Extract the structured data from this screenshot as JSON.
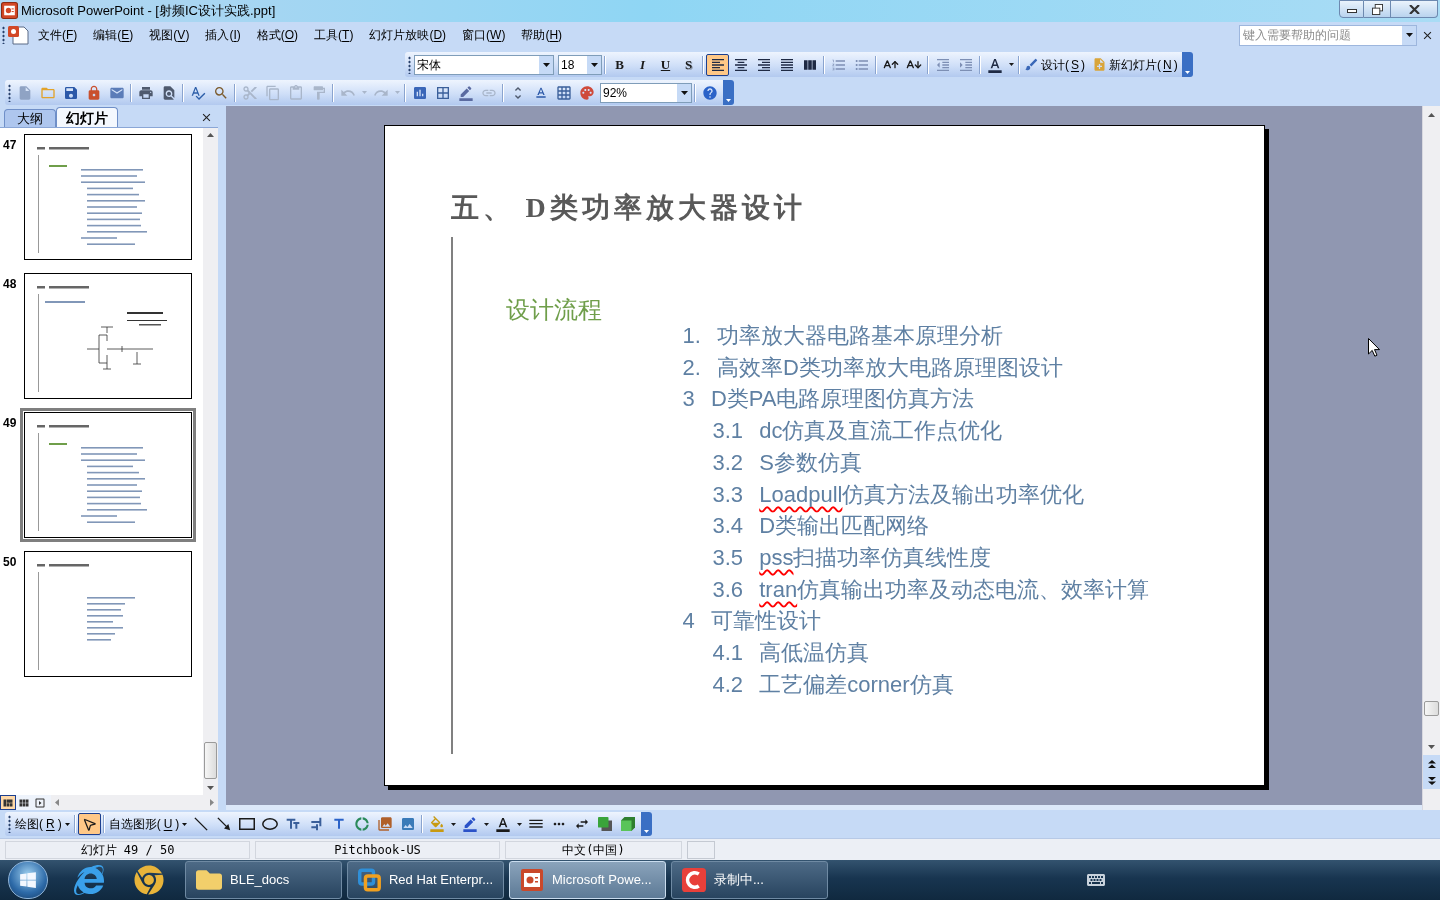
{
  "window": {
    "title": "Microsoft PowerPoint - [射频IC设计实践.ppt]"
  },
  "menu_bar": {
    "items": [
      "文件(F)",
      "编辑(E)",
      "视图(V)",
      "插入(I)",
      "格式(O)",
      "工具(T)",
      "幻灯片放映(D)",
      "窗口(W)",
      "帮助(H)"
    ],
    "help_box": {
      "placeholder": "键入需要帮助的问题"
    }
  },
  "formatting_toolbar": {
    "font": "宋体",
    "font_size": "18",
    "text_style_buttons": [
      {
        "label": "B",
        "selected": false
      },
      {
        "label": "I",
        "selected": false
      },
      {
        "label": "U",
        "selected": false
      },
      {
        "label": "S",
        "selected": false
      }
    ],
    "paragraph_buttons": [
      {
        "selected": true
      },
      {
        "selected": false
      },
      {
        "selected": false
      },
      {
        "selected": false
      },
      {
        "selected": false
      }
    ],
    "commands": [
      "设计(S)",
      "新幻灯片(N)"
    ]
  },
  "standard_toolbar": {
    "buttons": [
      {
        "disabled": false
      },
      {
        "disabled": false
      },
      {
        "disabled": false
      },
      {
        "disabled": false
      },
      {
        "disabled": false
      },
      {
        "disabled": false
      },
      {
        "disabled": false
      },
      {
        "disabled": false
      },
      {
        "disabled": false
      },
      {
        "disabled": true
      },
      {
        "disabled": true
      },
      {
        "disabled": true
      },
      {
        "disabled": true
      },
      {
        "disabled": true
      },
      {
        "disabled": true
      },
      {
        "disabled": false
      },
      {
        "disabled": false
      },
      {
        "disabled": false
      },
      {
        "disabled": true
      },
      {
        "disabled": false
      },
      {
        "disabled": false
      },
      {
        "disabled": false
      },
      {
        "disabled": false
      }
    ],
    "zoom": "92%"
  },
  "slide_pane": {
    "tabs": [
      {
        "label": "大纲",
        "selected": false
      },
      {
        "label": "幻灯片",
        "selected": true
      }
    ],
    "slides": [
      {
        "number": "47",
        "kind": "outline",
        "selected": false
      },
      {
        "number": "48",
        "kind": "diagram",
        "selected": false
      },
      {
        "number": "49",
        "kind": "outline",
        "selected": true
      },
      {
        "number": "50",
        "kind": "list",
        "selected": false
      }
    ]
  },
  "slide": {
    "title": "五、 D类功率放大器设计",
    "heading": "设计流程",
    "outline": [
      {
        "number": "1.",
        "parts": [
          {
            "text": "功率放大器电路基本原理分析",
            "spell_error": false
          }
        ]
      },
      {
        "number": "2.",
        "parts": [
          {
            "text": "高效率D类功率放大电路原理图设计",
            "spell_error": false
          }
        ]
      },
      {
        "number": "3",
        "parts": [
          {
            "text": "D类PA电路原理图仿真方法",
            "spell_error": false
          }
        ],
        "children": [
          {
            "number": "3.1",
            "parts": [
              {
                "text": "dc仿真及直流工作点优化",
                "spell_error": false
              }
            ]
          },
          {
            "number": "3.2",
            "parts": [
              {
                "text": "S参数仿真",
                "spell_error": false
              }
            ]
          },
          {
            "number": "3.3",
            "parts": [
              {
                "text": "Loadpull",
                "spell_error": true
              },
              {
                "text": "仿真方法及输出功率优化",
                "spell_error": false
              }
            ]
          },
          {
            "number": "3.4",
            "parts": [
              {
                "text": "D类输出匹配网络",
                "spell_error": false
              }
            ]
          },
          {
            "number": "3.5",
            "parts": [
              {
                "text": "pss",
                "spell_error": true
              },
              {
                "text": "扫描功率仿真线性度",
                "spell_error": false
              }
            ]
          },
          {
            "number": "3.6",
            "parts": [
              {
                "text": "tran",
                "spell_error": true
              },
              {
                "text": "仿真输出功率及动态电流、效率计算",
                "spell_error": false
              }
            ]
          }
        ]
      },
      {
        "number": "4",
        "parts": [
          {
            "text": "可靠性设计",
            "spell_error": false
          }
        ],
        "children": [
          {
            "number": "4.1",
            "parts": [
              {
                "text": "高低温仿真",
                "spell_error": false
              }
            ]
          },
          {
            "number": "4.2",
            "parts": [
              {
                "text": "工艺偏差corner仿真",
                "spell_error": false
              }
            ]
          }
        ]
      }
    ]
  },
  "view_buttons": [
    {
      "selected": true
    },
    {
      "selected": false
    },
    {
      "selected": false
    }
  ],
  "drawing_toolbar": {
    "menus": [
      "绘图(R)",
      "自选图形(U)"
    ],
    "tools": [
      {
        "selected": true
      },
      {
        "selected": false
      },
      {
        "selected": false
      },
      {
        "selected": false
      },
      {
        "selected": false
      },
      {
        "selected": false
      },
      {
        "selected": false
      },
      {
        "selected": false
      },
      {
        "selected": false
      },
      {
        "selected": false
      },
      {
        "selected": false
      }
    ]
  },
  "status_bar": {
    "slide": "幻灯片 49 / 50",
    "design": "Pitchbook-US",
    "language": "中文(中国)"
  },
  "taskbar": {
    "windows": [
      {
        "label": "BLE_docs",
        "selected": false
      },
      {
        "label": "Red Hat Enterpr...",
        "selected": false
      },
      {
        "label": "Microsoft Powe...",
        "selected": true
      },
      {
        "label": "录制中...",
        "selected": false
      }
    ]
  }
}
